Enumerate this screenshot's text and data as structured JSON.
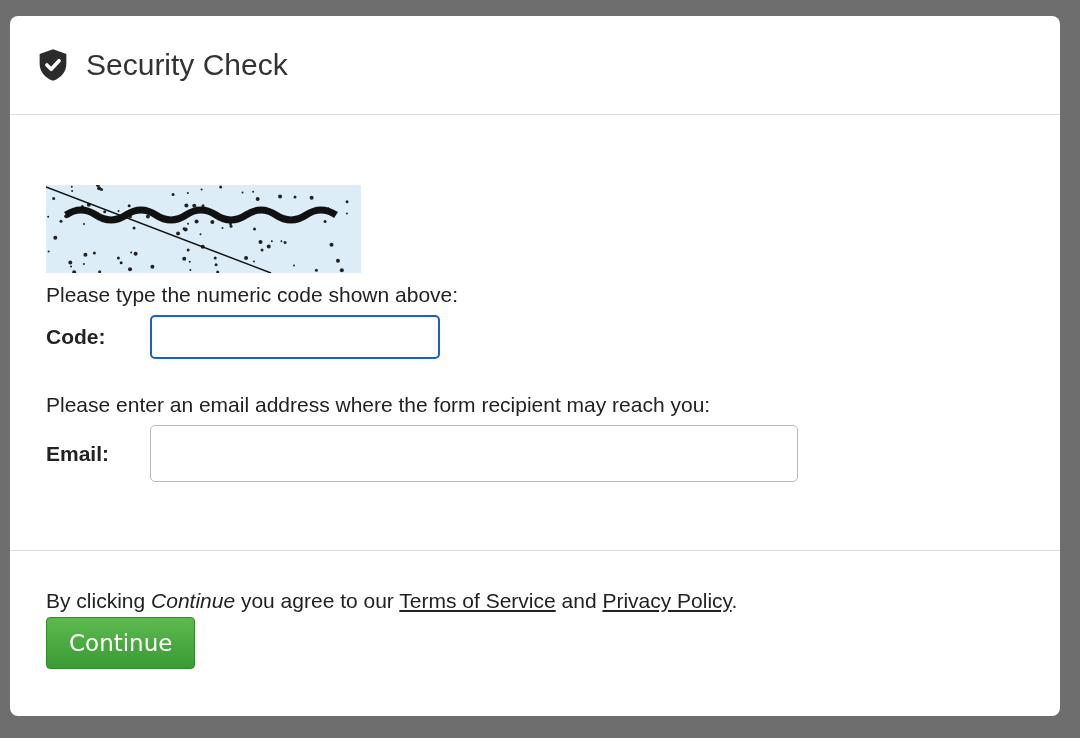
{
  "dialog": {
    "title": "Security Check"
  },
  "code_prompt": "Please type the numeric code shown above:",
  "fields": [
    {
      "label": "Code:",
      "focused": true,
      "kind": "short"
    },
    {
      "label": "Email:",
      "focused": false,
      "kind": "long",
      "prompt": "Please enter an email address where the form recipient may reach you:"
    }
  ],
  "agreement": [
    {
      "kind": "text",
      "text": "By clicking *Continue* you agree to our "
    },
    {
      "kind": "link",
      "text": "Terms of Service"
    },
    {
      "kind": "text",
      "text": " and "
    },
    {
      "kind": "link",
      "text": "Privacy Policy"
    },
    {
      "kind": "text",
      "text": "."
    }
  ],
  "button": "Continue"
}
